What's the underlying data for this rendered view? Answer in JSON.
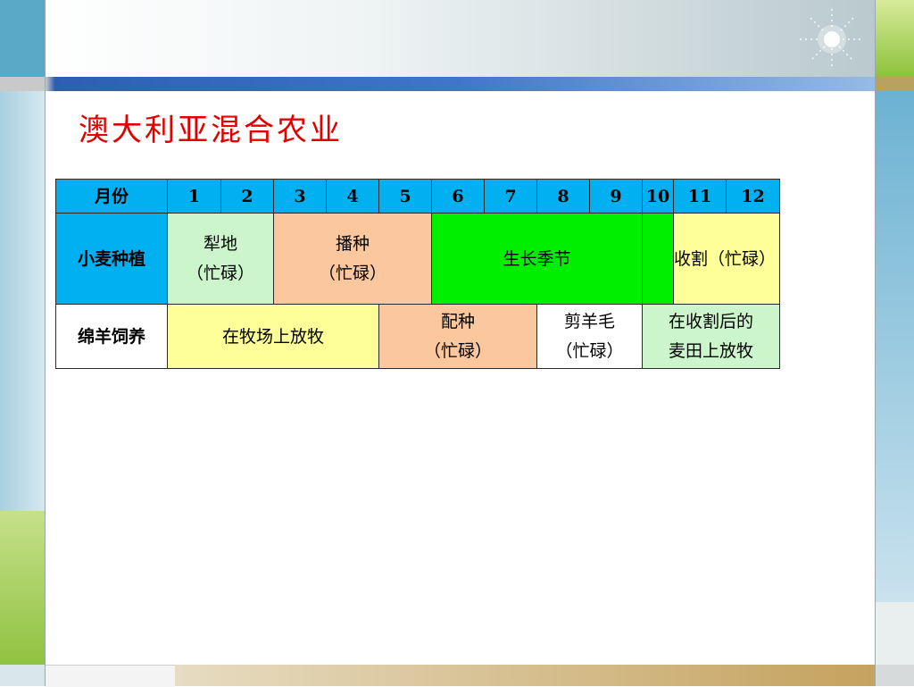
{
  "title": "澳大利亚混合农业",
  "table": {
    "header": {
      "label": "月份",
      "months": [
        "1",
        "2",
        "3",
        "4",
        "5",
        "6",
        "7",
        "8",
        "9",
        "10",
        "11",
        "12"
      ]
    },
    "wheat": {
      "label": "小麦种植",
      "plowing": {
        "line1": "犁地",
        "line2": "（忙碌）"
      },
      "sowing": {
        "line1": "播种",
        "line2": "（忙碌）"
      },
      "growing": "生长季节",
      "harvest": "收割（忙碌）"
    },
    "sheep": {
      "label": "绵羊饲养",
      "pasture": "在牧场上放牧",
      "breeding": {
        "line1": "配种",
        "line2": "（忙碌）"
      },
      "shearing": {
        "line1": "剪羊毛",
        "line2": "（忙碌）"
      },
      "stubble": {
        "line1": "在收割后的",
        "line2": "麦田上放牧"
      }
    }
  },
  "colors": {
    "title": "#e00000",
    "header": "#00b0f0",
    "mint": "#ccf5cc",
    "peach": "#fac79e",
    "green": "#00ee00",
    "yellow": "#ffff99"
  }
}
